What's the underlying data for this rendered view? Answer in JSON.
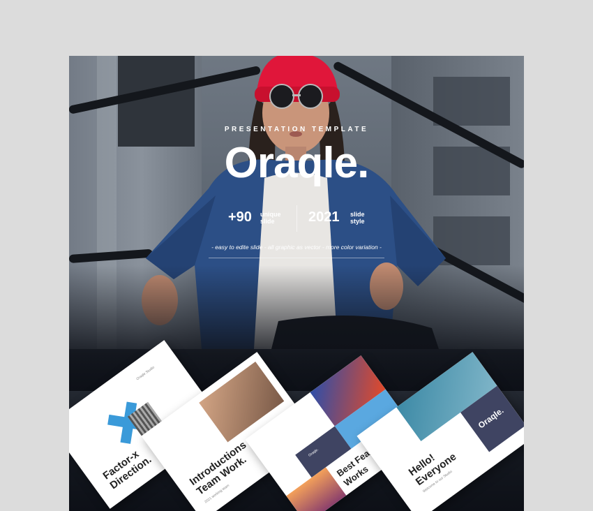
{
  "hero": {
    "kicker": "PRESENTATION TEMPLATE",
    "title": "Oraqle.",
    "stats": [
      {
        "number": "+90",
        "label_line1": "unique",
        "label_line2": "slide"
      },
      {
        "number": "2021",
        "label_line1": "slide",
        "label_line2": "style"
      }
    ],
    "features": "- easy to edite slide - all graphic as vector - more color variation -"
  },
  "slides": [
    {
      "title_line1": "Factor-x",
      "title_line2": "Direction.",
      "small_text": "Oraqle Studio"
    },
    {
      "title_line1": "Introductions",
      "title_line2": "Team Work.",
      "small_text": "2021 working team"
    },
    {
      "title_line1": "Best Featured Works",
      "small_text": "Oraqle."
    },
    {
      "title_line1": "Hello!",
      "title_line2": "Everyone",
      "side_label": "Oraqle.",
      "small_text": "Welcome to our Studio"
    }
  ],
  "colors": {
    "hat": "#e0163a",
    "jacket": "#2c4f86",
    "accent_blue": "#3a9ad9",
    "navy": "#3f4462",
    "background": "#dcdcdc"
  }
}
